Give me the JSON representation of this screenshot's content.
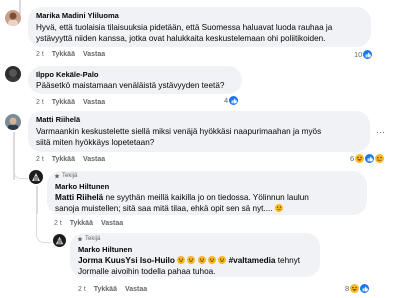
{
  "comments": [
    {
      "author": "Marika Madini Yliluoma",
      "text": "Hyvä, että tuolaisia tilaisuuksia pidetään, että Suomessa haluavat luoda rauhaa ja ystävyyttä niiden kanssa, jotka ovat halukkaita keskustelemaan ohi poliitikoiden.",
      "time": "2 t",
      "like": "Tykkää",
      "reply": "Vastaa",
      "reactions": "10"
    },
    {
      "author": "Ilppo Kekäle-Palo",
      "text": "Pääsetkö maistamaan venäläistä ystävyyden teetä?",
      "time": "2 t",
      "like": "Tykkää",
      "reply": "Vastaa",
      "reactions": "4"
    },
    {
      "author": "Matti Riihelä",
      "text": "Varmaankin keskustelette siellä miksi venäjä hyökkäsi naapurimaahan ja myös siitä miten hyökkäys lopetetaan?",
      "time": "2 t",
      "like": "Tykkää",
      "reply": "Vastaa",
      "reactions": "6"
    },
    {
      "badge": "Tekijä",
      "author": "Marko Hiltunen",
      "mention": "Matti Riihelä",
      "text": " ne syythän meillä kaikilla jo on tiedossa. Yölinnun laulun sanoja muistellen; sitä saa mitä tilaa, ehkä opit sen sä nyt....",
      "time": "2 t",
      "like": "Tykkää",
      "reply": "Vastaa"
    },
    {
      "badge": "Tekijä",
      "author": "Marko Hiltunen",
      "mention": "Jorma KuusYsi Iso-Huilo",
      "hashtag": "#valtamedia",
      "text": " tehnyt Jormalle aivoihin todella pahaa tuhoa.",
      "time": "2 t",
      "like": "Tykkää",
      "reply": "Vastaa",
      "reactions": "8"
    }
  ],
  "colors": {
    "bubble": "#f0f2f5",
    "meta": "#65676b",
    "like": "#1877f2",
    "emoji": "#f7b928"
  },
  "icons": [
    "like-icon",
    "laugh-emoji-icon",
    "sad-emoji-icon",
    "more-options-icon",
    "author-badge-icon"
  ]
}
